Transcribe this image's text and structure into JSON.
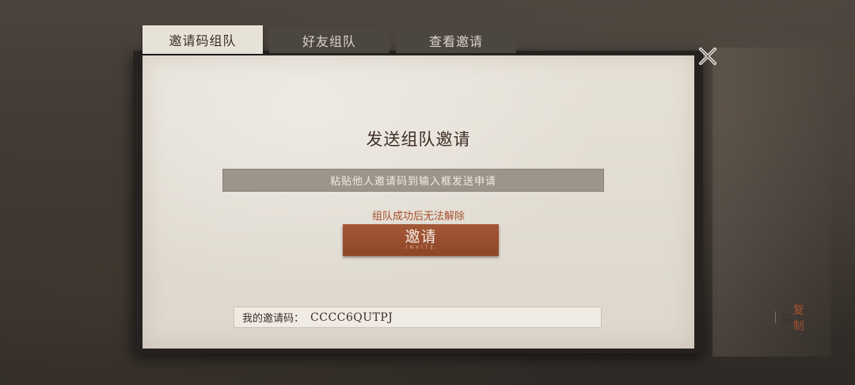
{
  "tabs": [
    {
      "label": "邀请码组队",
      "active": true
    },
    {
      "label": "好友组队",
      "active": false
    },
    {
      "label": "查看邀请",
      "active": false
    }
  ],
  "dialog": {
    "title": "发送组队邀请",
    "input_placeholder": "粘贴他人邀请码到输入框发送申请",
    "warning": "组队成功后无法解除",
    "invite_button": {
      "label": "邀请",
      "sub_label": "INVITE"
    },
    "my_code": {
      "label": "我的邀请码：",
      "value": "CCCC6QUTPJ",
      "copy_label": "复制"
    }
  },
  "icons": {
    "close": "close-icon",
    "copy": "copy-icon"
  },
  "colors": {
    "accent": "#a5502e",
    "button": "#9a4f30",
    "paper": "#e3ded4"
  }
}
